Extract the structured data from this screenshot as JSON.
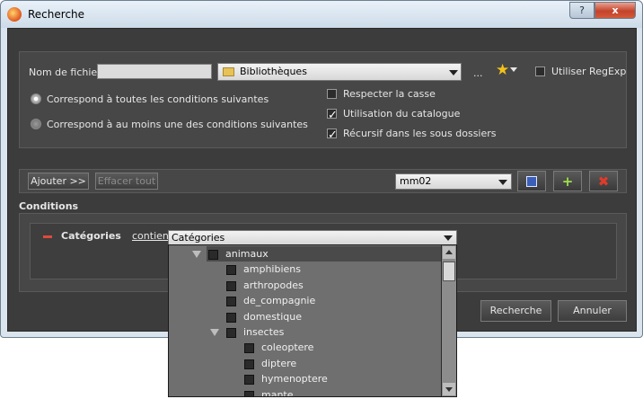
{
  "window": {
    "title": "Recherche",
    "help_label": "?",
    "close_label": "x"
  },
  "search": {
    "filename_label": "Nom de fichier",
    "filename_value": "",
    "location_value": "Bibliothèques",
    "browse_label": "...",
    "regexp_label": "Utiliser RegExp",
    "match_all_label": "Correspond à toutes les conditions suivantes",
    "match_any_label": "Correspond à au moins une des conditions suivantes",
    "case_label": "Respecter la casse",
    "catalog_label": "Utilisation du catalogue",
    "recursive_label": "Récursif dans les sous dossiers"
  },
  "toolbar": {
    "add_label": "Ajouter >>",
    "clear_label": "Effacer tout",
    "preset_value": "mm02"
  },
  "conditions": {
    "header": "Conditions",
    "remove_label": "−",
    "field_label": "Catégories",
    "operator_label": "contient",
    "value_selected": "Catégories"
  },
  "dropdown": {
    "items": [
      {
        "label": "animaux",
        "level": 0,
        "expanded": true
      },
      {
        "label": "amphibiens",
        "level": 1
      },
      {
        "label": "arthropodes",
        "level": 1
      },
      {
        "label": "de_compagnie",
        "level": 1
      },
      {
        "label": "domestique",
        "level": 1
      },
      {
        "label": "insectes",
        "level": 1,
        "expanded": true
      },
      {
        "label": "coleoptere",
        "level": 2
      },
      {
        "label": "diptere",
        "level": 2
      },
      {
        "label": "hymenoptere",
        "level": 2
      },
      {
        "label": "mante",
        "level": 2
      }
    ]
  },
  "actions": {
    "search_label": "Recherche",
    "cancel_label": "Annuler"
  }
}
